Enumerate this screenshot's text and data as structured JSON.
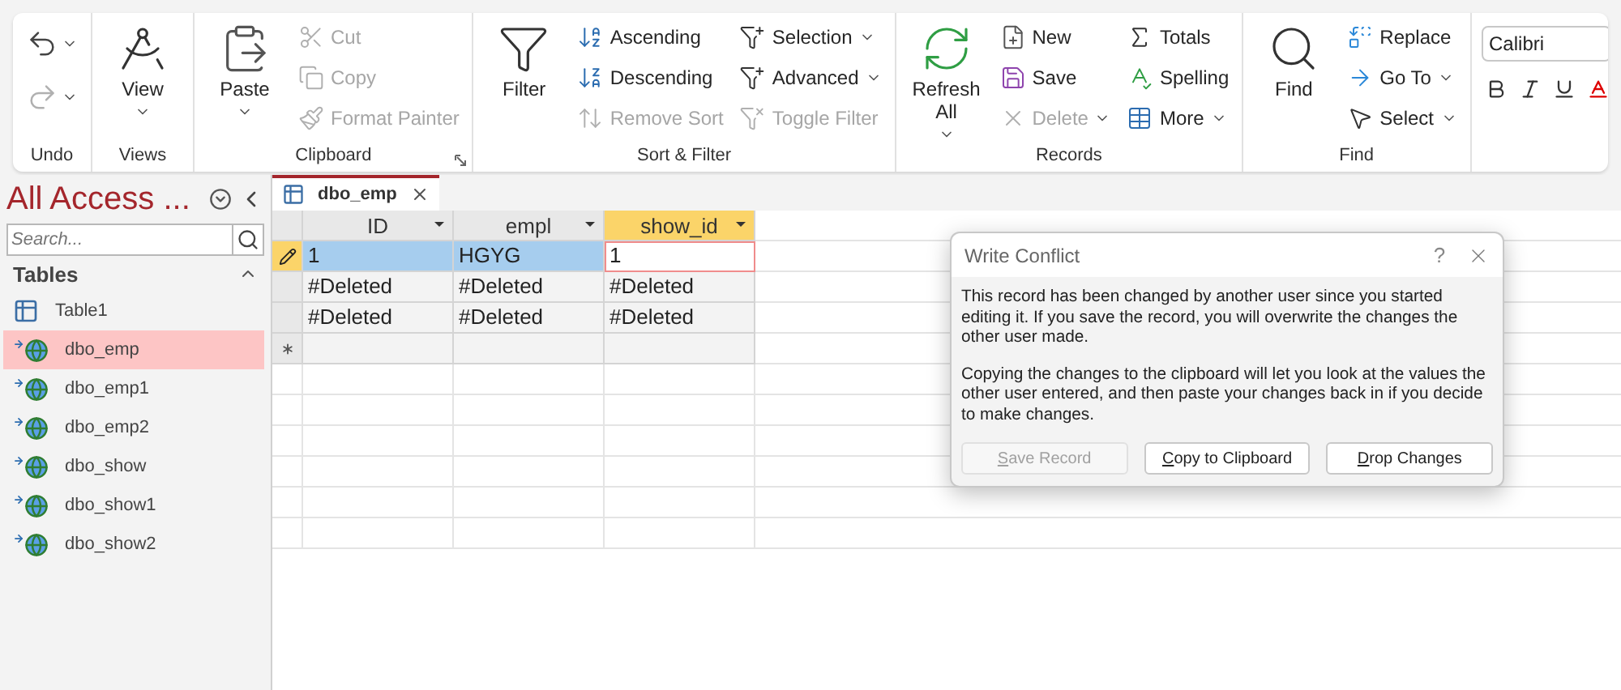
{
  "ribbon": {
    "groups": [
      {
        "label": "Undo",
        "columns": [
          [
            {
              "kind": "icon",
              "caret": true,
              "disabled": false
            },
            {
              "kind": "icon",
              "caret": true,
              "disabled": true
            }
          ]
        ]
      },
      {
        "label": "Views",
        "columns": [
          [
            {
              "label": "View",
              "kind": "large",
              "caret": true,
              "disabled": false
            }
          ]
        ]
      },
      {
        "label": "Clipboard",
        "launcher": true,
        "columns": [
          [
            {
              "label": "Paste",
              "kind": "large",
              "caret": true,
              "disabled": false
            }
          ],
          [
            {
              "label": "Cut",
              "kind": "small",
              "caret": false,
              "disabled": true
            },
            {
              "label": "Copy",
              "kind": "small",
              "caret": false,
              "disabled": true
            },
            {
              "label": "Format Painter",
              "kind": "small",
              "caret": false,
              "disabled": true
            }
          ]
        ]
      },
      {
        "label": "Sort & Filter",
        "columns": [
          [
            {
              "label": "Filter",
              "kind": "large",
              "caret": false,
              "disabled": false
            }
          ],
          [
            {
              "label": "Ascending",
              "kind": "small",
              "caret": false,
              "disabled": false
            },
            {
              "label": "Descending",
              "kind": "small",
              "caret": false,
              "disabled": false
            },
            {
              "label": "Remove Sort",
              "kind": "small",
              "caret": false,
              "disabled": true
            }
          ],
          [
            {
              "label": "Selection",
              "kind": "small",
              "caret": true,
              "disabled": false
            },
            {
              "label": "Advanced",
              "kind": "small",
              "caret": true,
              "disabled": false
            },
            {
              "label": "Toggle Filter",
              "kind": "small",
              "caret": false,
              "disabled": true
            }
          ]
        ]
      },
      {
        "label": "Records",
        "columns": [
          [
            {
              "label": "Refresh All",
              "kind": "large",
              "caret": true,
              "disabled": false
            }
          ],
          [
            {
              "label": "New",
              "kind": "small",
              "caret": false,
              "disabled": false
            },
            {
              "label": "Save",
              "kind": "small",
              "caret": false,
              "disabled": false
            },
            {
              "label": "Delete",
              "kind": "small",
              "caret": true,
              "disabled": true
            }
          ],
          [
            {
              "label": "Totals",
              "kind": "small",
              "caret": false,
              "disabled": false
            },
            {
              "label": "Spelling",
              "kind": "small",
              "caret": false,
              "disabled": false
            },
            {
              "label": "More",
              "kind": "small",
              "caret": true,
              "disabled": false
            }
          ]
        ]
      },
      {
        "label": "Find",
        "columns": [
          [
            {
              "label": "Find",
              "kind": "large",
              "caret": false,
              "disabled": false
            }
          ],
          [
            {
              "label": "Replace",
              "kind": "small",
              "caret": false,
              "disabled": false
            },
            {
              "label": "Go To",
              "kind": "small",
              "caret": true,
              "disabled": false
            },
            {
              "label": "Select",
              "kind": "small",
              "caret": true,
              "disabled": false
            }
          ]
        ]
      }
    ],
    "font": {
      "value": "Calibri"
    }
  },
  "nav": {
    "title": "All Access ...",
    "search": {
      "placeholder": "Search..."
    },
    "section": {
      "label": "Tables",
      "expanded": true
    },
    "items": [
      {
        "label": "Table1",
        "kind": "local",
        "selected": false
      },
      {
        "label": "dbo_emp",
        "kind": "linked",
        "selected": true
      },
      {
        "label": "dbo_emp1",
        "kind": "linked",
        "selected": false
      },
      {
        "label": "dbo_emp2",
        "kind": "linked",
        "selected": false
      },
      {
        "label": "dbo_show",
        "kind": "linked",
        "selected": false
      },
      {
        "label": "dbo_show1",
        "kind": "linked",
        "selected": false
      },
      {
        "label": "dbo_show2",
        "kind": "linked",
        "selected": false
      }
    ]
  },
  "document_tab": {
    "label": "dbo_emp",
    "selected": true
  },
  "table": {
    "columns": [
      {
        "label": "ID",
        "selected": false
      },
      {
        "label": "empl",
        "selected": false
      },
      {
        "label": "show_id",
        "selected": true
      }
    ],
    "rows": [
      {
        "kind": "editing",
        "selected": true,
        "cells": [
          "1",
          "HGYG",
          "1"
        ]
      },
      {
        "kind": "record",
        "selected": false,
        "cells": [
          "#Deleted",
          "#Deleted",
          "#Deleted"
        ]
      },
      {
        "kind": "record",
        "selected": false,
        "cells": [
          "#Deleted",
          "#Deleted",
          "#Deleted"
        ]
      },
      {
        "kind": "new",
        "selected": false,
        "cells": [
          "",
          "",
          ""
        ]
      }
    ]
  },
  "dialog": {
    "title": "Write Conflict",
    "help": "?",
    "paragraphs": [
      "This record has been changed by another user since you started editing it.  If you save the record, you will overwrite the changes the other user made.",
      "Copying the changes to the clipboard will let you look at the values the other user entered, and then paste your changes back in if you decide to make changes."
    ],
    "buttons": [
      {
        "label": "Save Record",
        "disabled": true
      },
      {
        "label": "Copy to Clipboard",
        "disabled": false
      },
      {
        "label": "Drop Changes",
        "disabled": false
      }
    ]
  }
}
